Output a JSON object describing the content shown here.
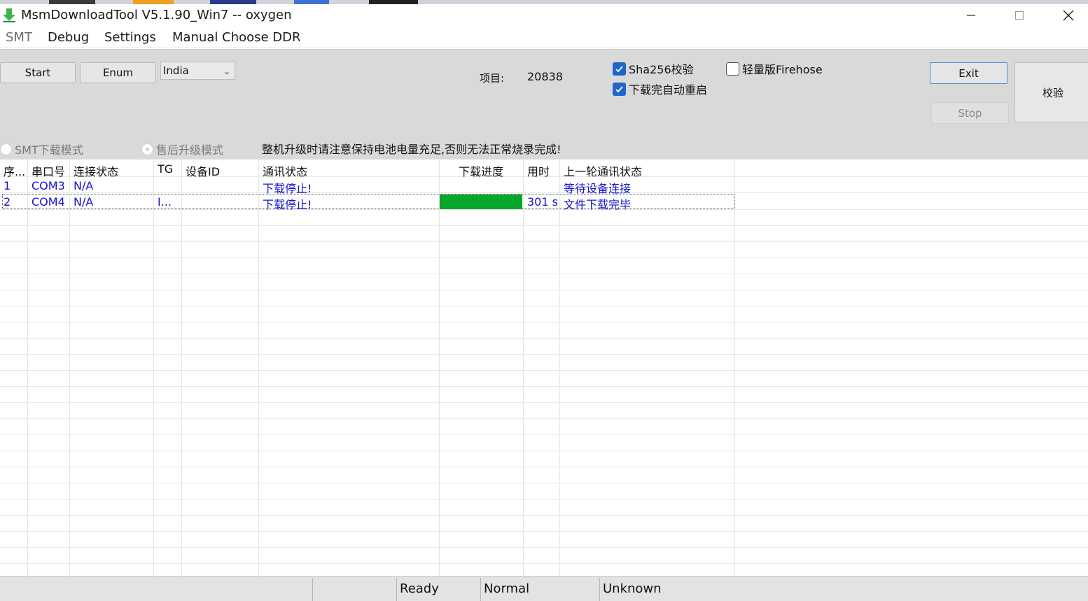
{
  "window": {
    "title": "MsmDownloadTool V5.1.90_Win7 -- oxygen",
    "accent_color": "#1f66cc"
  },
  "menu": {
    "smt": "SMT",
    "debug": "Debug",
    "settings": "Settings",
    "manual_ddr": "Manual Choose DDR"
  },
  "controls": {
    "start_label": "Start",
    "enum_label": "Enum",
    "region_value": "India",
    "project_label": "项目:",
    "project_value": "20838",
    "sha256_label": "Sha256校验",
    "sha256_checked": true,
    "auto_reboot_label": "下载完自动重启",
    "auto_reboot_checked": true,
    "light_firehose_label": "轻量版Firehose",
    "light_firehose_checked": false,
    "exit_label": "Exit",
    "stop_label": "Stop",
    "verify_label": "校验",
    "smt_mode_label": "SMT下载模式",
    "aftersale_mode_label": "售后升级模式",
    "warning": "整机升级时请注意保持电池电量充足,否则无法正常烧录完成!"
  },
  "table": {
    "columns": [
      "序...",
      "串口号",
      "连接状态",
      "TG",
      "设备ID",
      "通讯状态",
      "下载进度",
      "用时",
      "上一轮通讯状态"
    ],
    "rows": [
      {
        "index": "1",
        "port": "COM3",
        "conn": "N/A",
        "tg": "",
        "device_id": "",
        "comm": "下载停止!",
        "progress": 0,
        "time": "",
        "last_comm": "等待设备连接"
      },
      {
        "index": "2",
        "port": "COM4",
        "conn": "N/A",
        "tg": "I...",
        "device_id": "",
        "comm": "下载停止!",
        "progress": 1,
        "time": "301 s",
        "last_comm": "文件下载完毕"
      }
    ],
    "progress_color": "#06a62c"
  },
  "status": {
    "ready": "Ready",
    "normal": "Normal",
    "unknown": "Unknown"
  }
}
